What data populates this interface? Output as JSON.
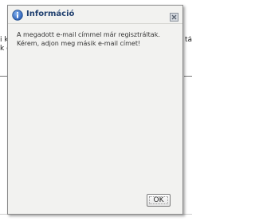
{
  "background": {
    "left_fragment_line1": "i k",
    "left_fragment_line2": "k e",
    "right_fragment_line1": "tán"
  },
  "dialog": {
    "title": "Információ",
    "icon": "info-icon",
    "close_icon": "close-icon",
    "message_line1": "A megadott e-mail címmel már regisztráltak.",
    "message_line2": "Kérem, adjon meg másik e-mail címet!",
    "ok_label": "OK"
  },
  "colors": {
    "title_text": "#1f3f6e",
    "icon_blue": "#3a6fc4",
    "dialog_bg": "#f2f2f0"
  }
}
